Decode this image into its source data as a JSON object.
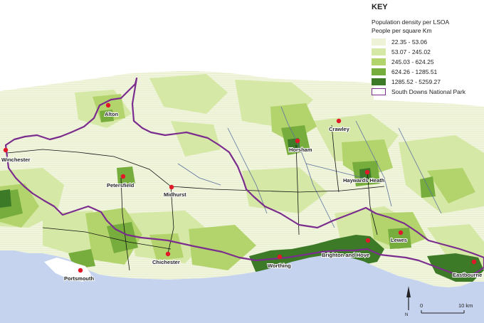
{
  "key": {
    "title": "KEY",
    "subtitle1": "Population density per LSOA",
    "subtitle2": "People per square Km",
    "classes": [
      {
        "label": "22.35 - 53.06",
        "color": "#eef3d7"
      },
      {
        "label": "53.07 - 245.02",
        "color": "#d6e8a6"
      },
      {
        "label": "245.03 - 624.25",
        "color": "#b3d46d"
      },
      {
        "label": "624.26 - 1285.51",
        "color": "#76ad3c"
      },
      {
        "label": "1285.52 - 5259.27",
        "color": "#3d7a28"
      }
    ],
    "boundary_label": "South Downs National Park",
    "boundary_color": "#7b2d8e"
  },
  "towns": [
    {
      "name": "Alton"
    },
    {
      "name": "Winchester"
    },
    {
      "name": "Petersfield"
    },
    {
      "name": "Midhurst"
    },
    {
      "name": "Chichester"
    },
    {
      "name": "Portsmouth"
    },
    {
      "name": "Worthing"
    },
    {
      "name": "Brighton and Hove"
    },
    {
      "name": "Lewes"
    },
    {
      "name": "Eastbourne"
    },
    {
      "name": "Horsham"
    },
    {
      "name": "Crawley"
    },
    {
      "name": "Haywards Heath"
    }
  ],
  "scale": {
    "start": "0",
    "end": "10 km"
  },
  "north": {
    "label": "N"
  },
  "colors": {
    "sea": "#c5d3ef",
    "river": "#5b6f9e",
    "road": "#111111",
    "town_marker": "#e0182a"
  }
}
